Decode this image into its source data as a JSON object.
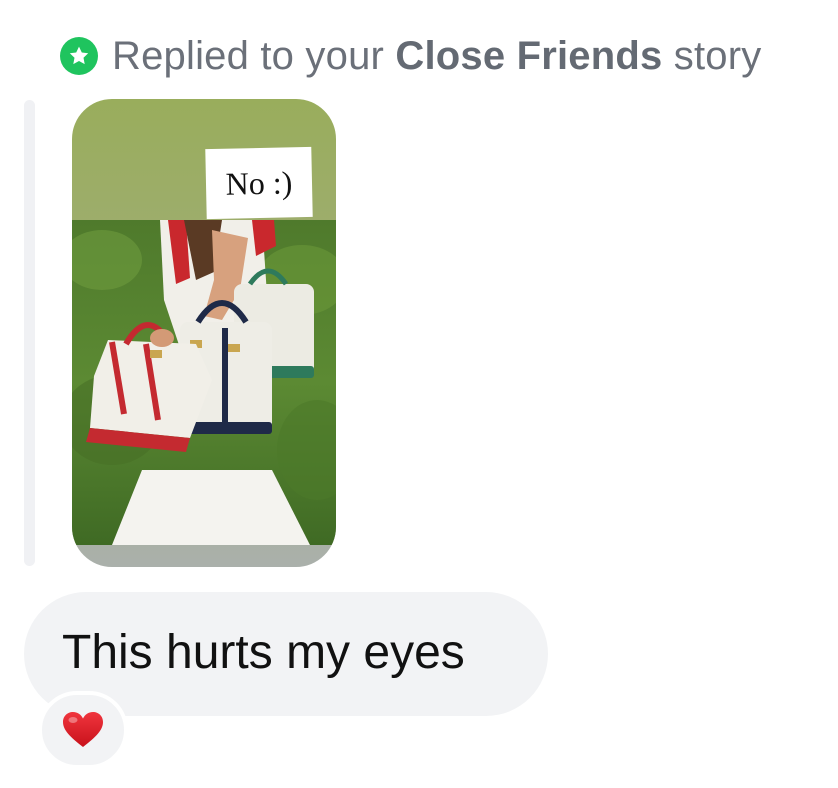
{
  "reply_header": {
    "prefix": "Replied to your ",
    "highlight": "Close Friends",
    "suffix": " story",
    "icon": "star-icon",
    "icon_color": "#1fc45e"
  },
  "story": {
    "caption": "No :)"
  },
  "message": {
    "text": "This hurts my eyes"
  },
  "reaction": {
    "icon": "heart-icon",
    "color": "#e0202a"
  }
}
